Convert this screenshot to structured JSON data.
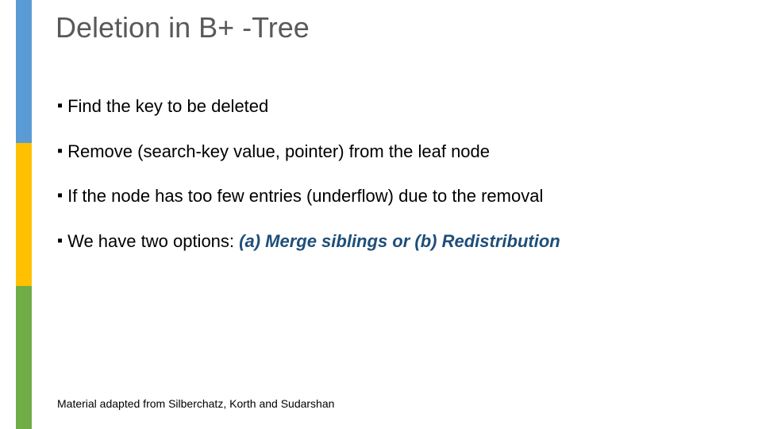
{
  "title": "Deletion in B+ -Tree",
  "bullets": [
    {
      "text": "Find the key to be deleted"
    },
    {
      "text": "Remove (search-key value, pointer) from the leaf node"
    },
    {
      "text": "If the node has too few entries (underflow) due to the removal"
    },
    {
      "prefix": "We have two options: ",
      "emphasis": "(a) Merge siblings or (b) Redistribution"
    }
  ],
  "footer": "Material adapted from Silberchatz, Korth and Sudarshan"
}
